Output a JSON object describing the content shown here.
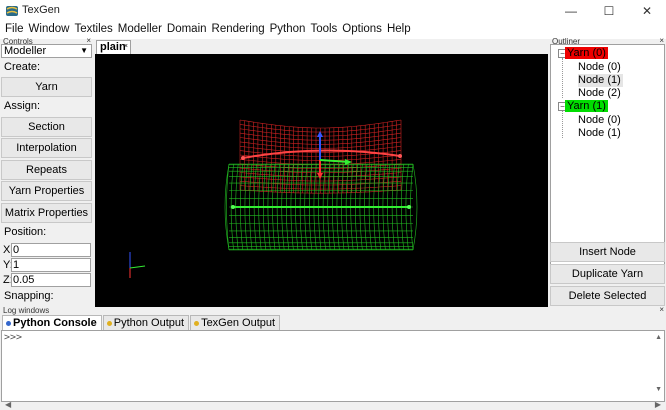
{
  "window": {
    "title": "TexGen",
    "minimize": "—",
    "maximize": "☐",
    "close": "✕"
  },
  "menu": [
    "File",
    "Window",
    "Textiles",
    "Modeller",
    "Domain",
    "Rendering",
    "Python",
    "Tools",
    "Options",
    "Help"
  ],
  "controls": {
    "dock_title": "Controls",
    "mode": "Modeller",
    "create_label": "Create:",
    "yarn_button": "Yarn",
    "assign_label": "Assign:",
    "assign_buttons": [
      "Section",
      "Interpolation",
      "Repeats",
      "Yarn Properties",
      "Matrix Properties"
    ],
    "position_label": "Position:",
    "position": {
      "x_label": "X:",
      "x": "0",
      "y_label": "Y:",
      "y": "1",
      "z_label": "Z:",
      "z": "0.05"
    },
    "snapping_label": "Snapping:"
  },
  "viewport": {
    "tab_label": "plain",
    "background": "#000000",
    "yarn0_color": "#cc2222",
    "yarn1_color": "#22bb22"
  },
  "outliner": {
    "dock_title": "Outliner",
    "yarns": [
      {
        "label": "Yarn (0)",
        "color": "#ee0000",
        "nodes": [
          "Node (0)",
          "Node (1)",
          "Node (2)"
        ]
      },
      {
        "label": "Yarn (1)",
        "color": "#00dd00",
        "nodes": [
          "Node (0)",
          "Node (1)"
        ]
      }
    ],
    "buttons": [
      "Insert Node",
      "Duplicate Yarn",
      "Delete Selected"
    ]
  },
  "log": {
    "dock_title": "Log windows",
    "tabs": [
      {
        "label": "Python Console",
        "dot": "#3366cc"
      },
      {
        "label": "Python Output",
        "dot": "#e0b020"
      },
      {
        "label": "TexGen Output",
        "dot": "#e0b020"
      }
    ],
    "prompt": ">>>"
  }
}
